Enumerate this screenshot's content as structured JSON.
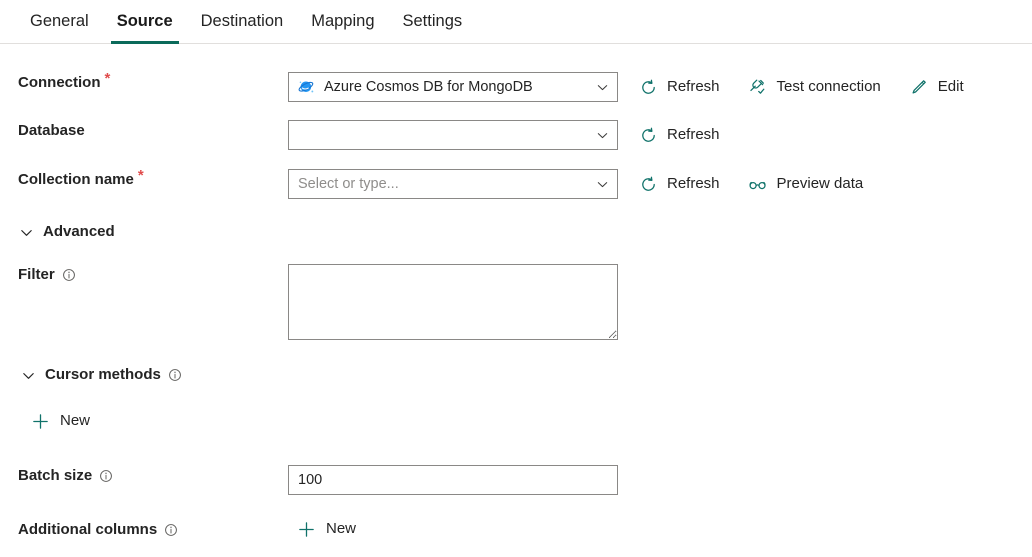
{
  "colors": {
    "accent_teal": "#0b6a5a",
    "icon_teal": "#10726a",
    "required_red": "#e04b4b",
    "cosmos_blue": "#2196f3",
    "border": "#8a8886",
    "text": "#242424",
    "placeholder": "#8f8d8b"
  },
  "tabs": [
    {
      "label": "General",
      "active": false
    },
    {
      "label": "Source",
      "active": true
    },
    {
      "label": "Destination",
      "active": false
    },
    {
      "label": "Mapping",
      "active": false
    },
    {
      "label": "Settings",
      "active": false
    }
  ],
  "connection": {
    "label": "Connection",
    "required": "*",
    "value": "Azure Cosmos DB for MongoDB",
    "icon": "cosmos-db-icon",
    "chevron": "chevron-down-icon",
    "actions": [
      {
        "label": "Refresh",
        "icon": "refresh-icon"
      },
      {
        "label": "Test connection",
        "icon": "plug-check-icon"
      },
      {
        "label": "Edit",
        "icon": "pencil-icon"
      }
    ]
  },
  "database": {
    "label": "Database",
    "value": "",
    "placeholder": "",
    "chevron": "chevron-down-icon",
    "actions": [
      {
        "label": "Refresh",
        "icon": "refresh-icon"
      }
    ]
  },
  "collection": {
    "label": "Collection name",
    "required": "*",
    "value": "",
    "placeholder": "Select or type...",
    "chevron": "chevron-down-icon",
    "actions": [
      {
        "label": "Refresh",
        "icon": "refresh-icon"
      },
      {
        "label": "Preview data",
        "icon": "glasses-icon"
      }
    ]
  },
  "advanced": {
    "label": "Advanced",
    "chevron": "chevron-down-icon"
  },
  "filter": {
    "label": "Filter",
    "info": "info-icon",
    "value": "",
    "placeholder": ""
  },
  "cursor_methods": {
    "label": "Cursor methods",
    "info": "info-icon",
    "chevron": "chevron-down-icon",
    "new_label": "New",
    "new_icon": "plus-icon"
  },
  "batch_size": {
    "label": "Batch size",
    "info": "info-icon",
    "value": "100"
  },
  "additional_columns": {
    "label": "Additional columns",
    "info": "info-icon",
    "new_label": "New",
    "new_icon": "plus-icon"
  }
}
